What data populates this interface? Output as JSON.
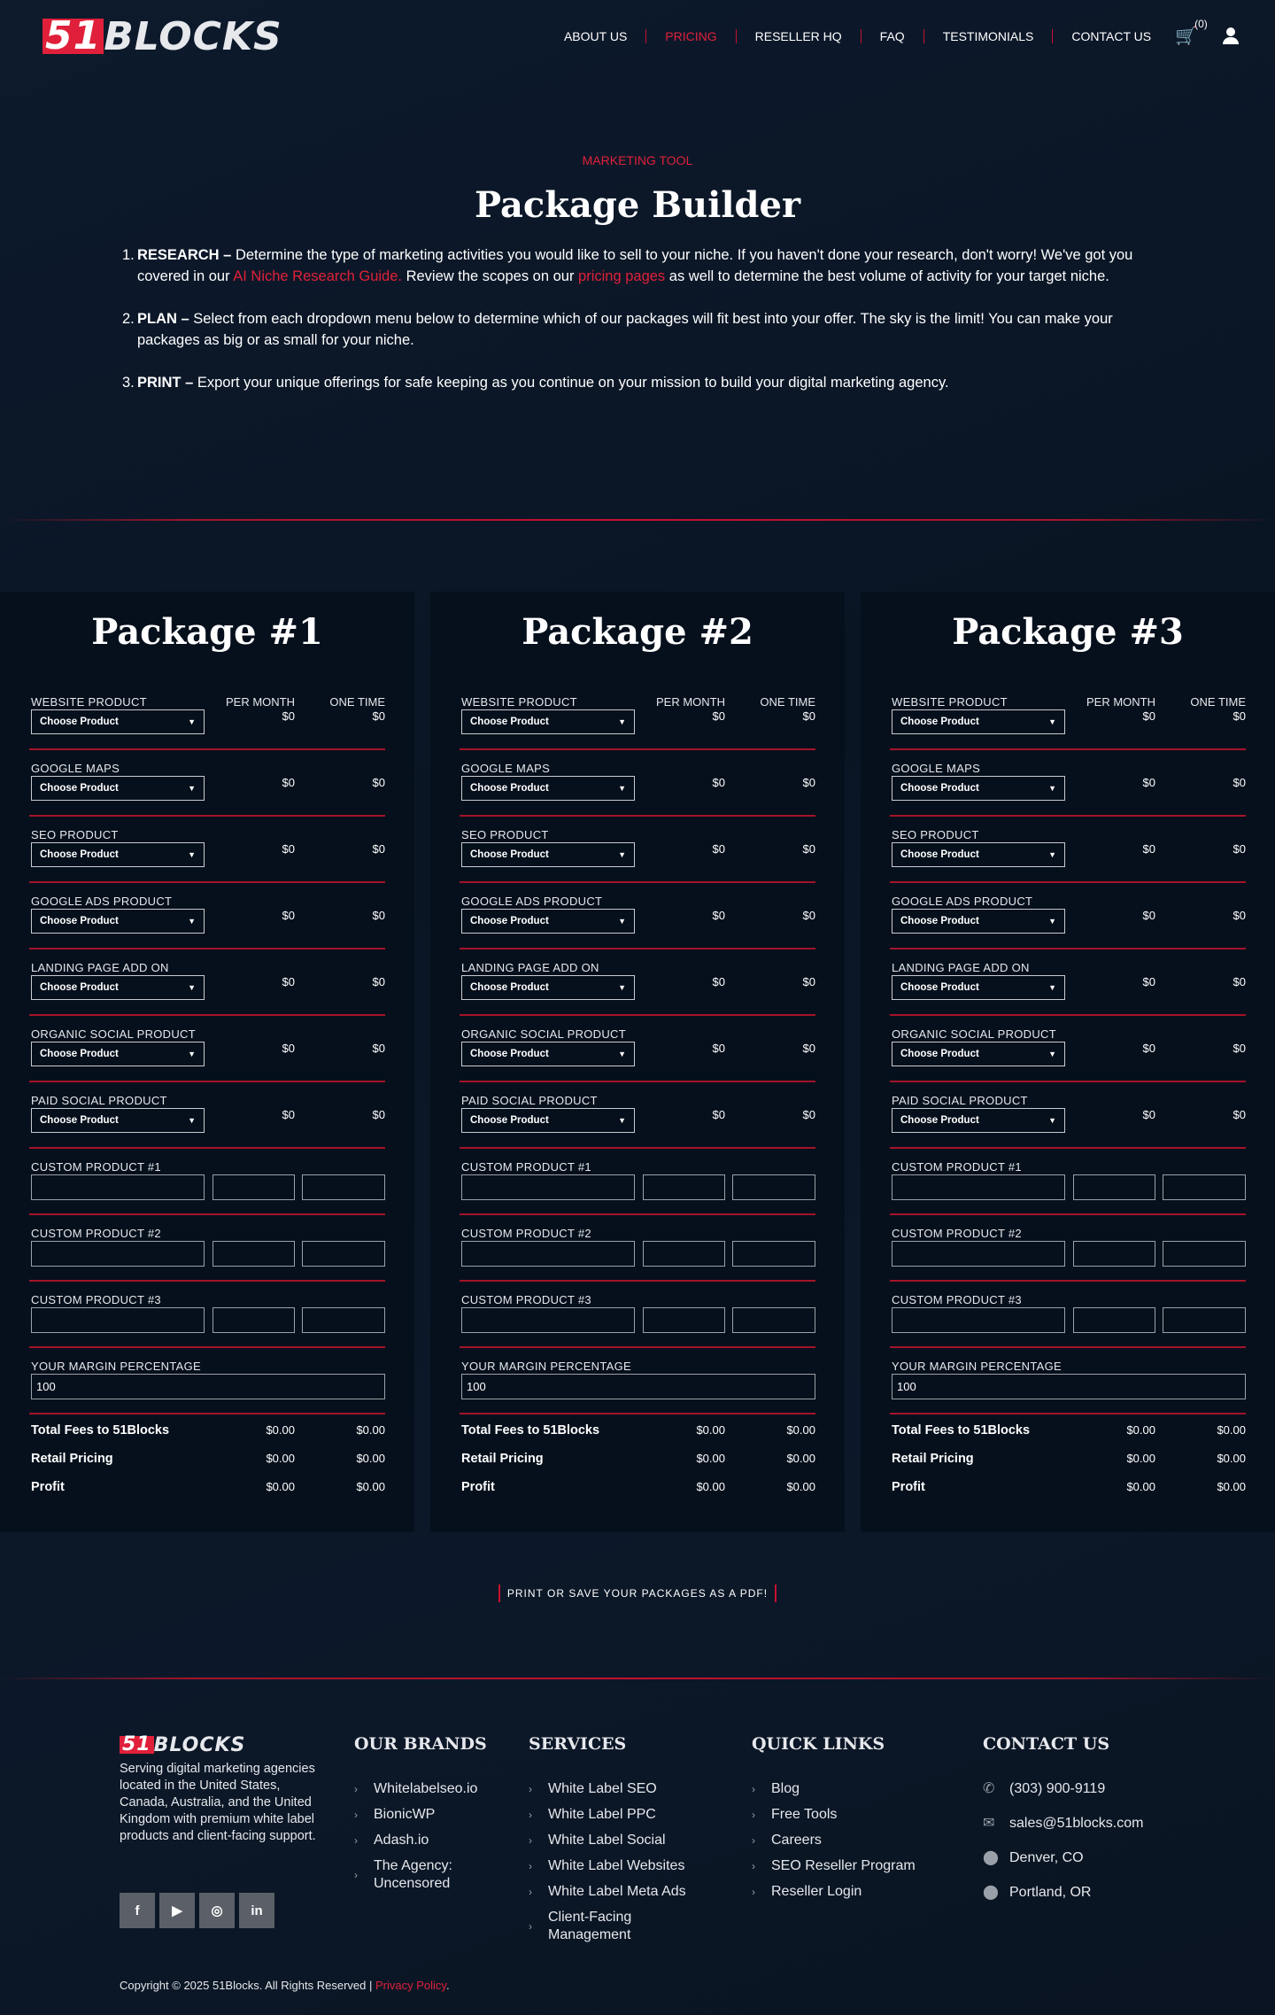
{
  "header": {
    "logo": {
      "num": "51",
      "word": "BLOCKS"
    },
    "nav": [
      {
        "label": "ABOUT US"
      },
      {
        "label": "PRICING",
        "active": true
      },
      {
        "label": "RESELLER HQ"
      },
      {
        "label": "FAQ"
      },
      {
        "label": "TESTIMONIALS"
      },
      {
        "label": "CONTACT US"
      }
    ],
    "cart_count": "(0)"
  },
  "hero": {
    "eyebrow": "MARKETING TOOL",
    "title": "Package Builder",
    "steps": [
      {
        "num": "1.",
        "label": "RESEARCH –",
        "text1": " Determine the type of marketing activities you would like to sell to your niche. If you haven't done your research, don't worry! We've got you covered in our ",
        "link1": "AI Niche Research Guide.",
        "text2": " Review the scopes on our ",
        "link2": "pricing pages",
        "text3": " as well to determine the best volume of activity for your target niche."
      },
      {
        "num": "2.",
        "label": "PLAN –",
        "text1": " Select from each dropdown menu below to determine which of our packages will fit best into your offer. The sky is the limit! You can make your packages as big or as small for your niche."
      },
      {
        "num": "3.",
        "label": "PRINT –",
        "text1": " Export your unique offerings for safe keeping as you continue on your mission to build your digital marketing agency."
      }
    ]
  },
  "columns": {
    "per_month": "PER MONTH",
    "one_time": "ONE TIME"
  },
  "product_rows": [
    {
      "label": "WEBSITE PRODUCT",
      "select": "Choose Product",
      "per_month": "$0",
      "one_time": "$0"
    },
    {
      "label": "GOOGLE MAPS",
      "select": "Choose Product",
      "per_month": "$0",
      "one_time": "$0"
    },
    {
      "label": "SEO PRODUCT",
      "select": "Choose Product",
      "per_month": "$0",
      "one_time": "$0"
    },
    {
      "label": "GOOGLE ADS PRODUCT",
      "select": "Choose Product",
      "per_month": "$0",
      "one_time": "$0"
    },
    {
      "label": "LANDING PAGE ADD ON",
      "select": "Choose Product",
      "per_month": "$0",
      "one_time": "$0"
    },
    {
      "label": "ORGANIC SOCIAL PRODUCT",
      "select": "Choose Product",
      "per_month": "$0",
      "one_time": "$0"
    },
    {
      "label": "PAID SOCIAL PRODUCT",
      "select": "Choose Product",
      "per_month": "$0",
      "one_time": "$0"
    }
  ],
  "custom_rows": [
    {
      "label": "CUSTOM PRODUCT #1"
    },
    {
      "label": "CUSTOM PRODUCT #2"
    },
    {
      "label": "CUSTOM PRODUCT #3"
    }
  ],
  "margin": {
    "label": "YOUR MARGIN PERCENTAGE",
    "value": "100"
  },
  "totals": [
    {
      "label": "Total Fees to 51Blocks",
      "per_month": "$0.00",
      "one_time": "$0.00"
    },
    {
      "label": "Retail Pricing",
      "per_month": "$0.00",
      "one_time": "$0.00"
    },
    {
      "label": "Profit",
      "per_month": "$0.00",
      "one_time": "$0.00"
    }
  ],
  "packages": [
    {
      "title": "Package #1"
    },
    {
      "title": "Package #2"
    },
    {
      "title": "Package #3"
    }
  ],
  "print_button": "PRINT OR SAVE YOUR PACKAGES AS A PDF!",
  "footer": {
    "blurb": "Serving digital marketing agencies located in the United States, Canada, Australia, and the United Kingdom with premium white label products and client-facing support.",
    "social": [
      {
        "icon": "facebook-icon",
        "glyph": "f"
      },
      {
        "icon": "youtube-icon",
        "glyph": "▶"
      },
      {
        "icon": "instagram-icon",
        "glyph": "◎"
      },
      {
        "icon": "linkedin-icon",
        "glyph": "in"
      }
    ],
    "brands": {
      "heading": "OUR BRANDS",
      "items": [
        "Whitelabelseo.io",
        "BionicWP",
        "Adash.io",
        "The Agency: Uncensored"
      ]
    },
    "services": {
      "heading": "SERVICES",
      "items": [
        "White Label SEO",
        "White Label PPC",
        "White Label Social",
        "White Label Websites",
        "White Label Meta Ads",
        "Client-Facing Management"
      ]
    },
    "quick": {
      "heading": "QUICK LINKS",
      "items": [
        "Blog",
        "Free Tools",
        "Careers",
        "SEO Reseller Program",
        "Reseller Login"
      ]
    },
    "contact": {
      "heading": "CONTACT US",
      "items": [
        {
          "icon": "phone-icon",
          "glyph": "✆",
          "text": "(303) 900-9119"
        },
        {
          "icon": "email-icon",
          "glyph": "✉",
          "text": "sales@51blocks.com"
        },
        {
          "icon": "location-pin-icon",
          "glyph": "⬤",
          "text": "Denver, CO"
        },
        {
          "icon": "location-pin-icon",
          "glyph": "⬤",
          "text": "Portland, OR"
        }
      ]
    },
    "copyright": "Copyright © 2025 51Blocks. All Rights Reserved | ",
    "privacy": "Privacy Policy",
    "period": "."
  },
  "colors": {
    "accent": "#e0203a",
    "background": "#0b1627",
    "card": "#06101c"
  }
}
